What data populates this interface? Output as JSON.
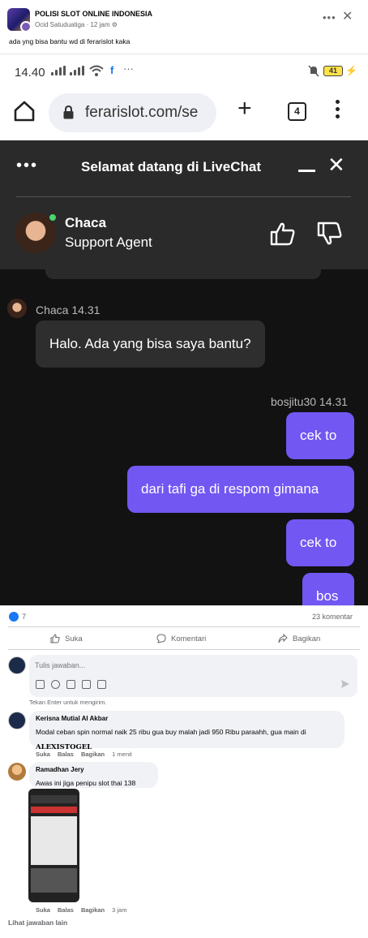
{
  "post": {
    "group_name": "POLISI SLOT ONLINE INDONESIA",
    "author": "Ocid Satuduatiga",
    "time": "12 jam",
    "text": "ada yng bisa bantu wd di ferarislot kaka"
  },
  "screenshot": {
    "status": {
      "time": "14.40",
      "battery": "41",
      "dots": "···"
    },
    "browser": {
      "url": "ferarislot.com/se",
      "tab_count": "4"
    },
    "livechat": {
      "title": "Selamat datang di LiveChat",
      "agent_name": "Chaca",
      "agent_role": "Support Agent"
    },
    "messages": [
      {
        "meta": "Chaca 14.31",
        "text": "Halo. Ada yang bisa saya bantu?"
      },
      {
        "meta": "bosjitu30 14.31",
        "text": "cek to"
      },
      {
        "text": "dari tafi ga di respom gimana"
      },
      {
        "text": "cek to"
      },
      {
        "text": "bos"
      }
    ]
  },
  "reactions": {
    "likes": "7",
    "comments": "23 komentar"
  },
  "actions": {
    "like": "Suka",
    "comment": "Komentari",
    "share": "Bagikan"
  },
  "composer": {
    "placeholder": "Tulis jawaban...",
    "hint": "Tekan Enter untuk mengirim."
  },
  "comments": [
    {
      "name": "Kerisna Mutial Al Akbar",
      "text": "Modal ceban spin normal naik 25 ribu gua buy malah jadi 950 Ribu paraahh, gua main di",
      "brand": "ALEXISTOGEL",
      "like": "Suka",
      "reply": "Balas",
      "share": "Bagikan",
      "time": "1 menit"
    },
    {
      "name": "Ramadhan Jery",
      "text": "Awas ini jiga penipu slot thai 138",
      "like": "Suka",
      "reply": "Balas",
      "share": "Bagikan",
      "time": "3 jam"
    }
  ],
  "more_replies": "Lihat jawaban lain",
  "colors": {
    "user_bubble": "#7257f2",
    "chat_bg": "#121212",
    "fb_blue": "#1877f2"
  }
}
